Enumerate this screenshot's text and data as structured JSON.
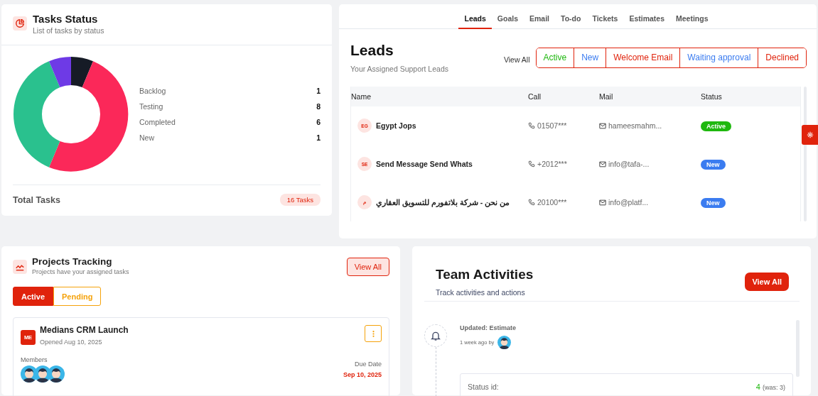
{
  "tasks_status": {
    "title": "Tasks Status",
    "subtitle": "List of tasks by status",
    "legend": [
      {
        "label": "Backlog",
        "count": "1",
        "color": "#161b26"
      },
      {
        "label": "Testing",
        "count": "8",
        "color": "#fb2859"
      },
      {
        "label": "Completed",
        "count": "6",
        "color": "#2ac18e"
      },
      {
        "label": "New",
        "count": "1",
        "color": "#6e3ae6"
      }
    ],
    "total_label": "Total Tasks",
    "total_badge": "16 Tasks"
  },
  "tabs": [
    {
      "label": "Leads",
      "selected": true
    },
    {
      "label": "Goals",
      "selected": false
    },
    {
      "label": "Email",
      "selected": false
    },
    {
      "label": "To-do",
      "selected": false
    },
    {
      "label": "Tickets",
      "selected": false
    },
    {
      "label": "Estimates",
      "selected": false
    },
    {
      "label": "Meetings",
      "selected": false
    }
  ],
  "leads": {
    "title": "Leads",
    "subtitle": "Your Assigned Support Leads",
    "view_all": "View All",
    "filters": [
      {
        "label": "Active",
        "color": "#1fb80f"
      },
      {
        "label": "New",
        "color": "#3b7cf0"
      },
      {
        "label": "Welcome Email",
        "color": "#e0230c"
      },
      {
        "label": "Waiting approval",
        "color": "#3b7cf0"
      },
      {
        "label": "Declined",
        "color": "#e0230c"
      }
    ],
    "columns": [
      "Name",
      "Call",
      "Mail",
      "Status"
    ],
    "rows": [
      {
        "initials": "EG",
        "name": "Egypt Jops",
        "call": "01507***",
        "mail": "hameesmahm...",
        "status": "Active",
        "color": "#1fb80f"
      },
      {
        "initials": "SE",
        "name": "Send Message Send Whats",
        "call": "+2012***",
        "mail": "info@tafa-...",
        "status": "New",
        "color": "#3b7cf0"
      },
      {
        "initials": "م",
        "name": "من نحن - شركة بلاتفورم للتسويق العقاري",
        "call": "20100***",
        "mail": "info@platf...",
        "status": "New",
        "color": "#3b7cf0"
      }
    ]
  },
  "projects": {
    "title": "Projects Tracking",
    "subtitle": "Projects have your assigned tasks",
    "view_all": "View All",
    "tabs": [
      {
        "label": "Active",
        "selected": true
      },
      {
        "label": "Pending",
        "selected": false
      }
    ],
    "card": {
      "initials": "ME",
      "name": "Medians CRM Launch",
      "opened": "Opened Aug 10, 2025",
      "members_label": "Members",
      "due_label": "Due Date",
      "due": "Sep 10, 2025"
    }
  },
  "activities": {
    "title": "Team Activities",
    "subtitle": "Track activities and actions",
    "view_all": "View All",
    "items": [
      {
        "title": "Updated: Estimate",
        "time": "1 week ago by",
        "field": "Status id:",
        "new_value": "4",
        "old_value": "(was: 3)"
      }
    ]
  }
}
